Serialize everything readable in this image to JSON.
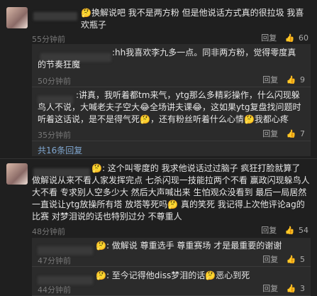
{
  "comments": [
    {
      "text": "🤔换解说吧 我不是两方粉 但是他说话方式真的很拉圾 我喜欢瓶子",
      "time": "55分钟前",
      "reply_label": "回复",
      "likes": "60",
      "replies": [
        {
          "text": ":hh我喜欢李九多一点。同非两方粉，觉得零度真的节奏狂魔",
          "time": "50分钟前",
          "reply_label": "回复",
          "likes": "9"
        },
        {
          "text": ":讲真，我听着都tm来气，ytg那么多精彩操作，什么闪现躲鸟人不说，大喊老夫子空大😂全场讲夫课😂，这如果ytg复盘找问题时听着这话说，是不是得气死🤔，还有粉丝听着什么心情🤔我都心疼",
          "time": "35分钟前",
          "reply_label": "回复",
          "likes": "7"
        }
      ],
      "more_label": "共16条回复"
    },
    {
      "text": "🤔: 这个叫零度的 我求他说话过过脑子 疯狂打脸就算了 做解说从来不看人家发挥完点 七杀闪现一技能拉两个不看 赢政闪现躲鸟人大不看 专求别人空多少大 然后大声喊出来 生怕观众没看到 最后一局居然一直说让ytg放操所有塔 放塔等死吗🤔 真的笑死 我记得上次他评论ag的比赛 对梦泪说的话也特别过分 不尊重人",
      "time": "48分钟前",
      "reply_label": "回复",
      "likes": "54",
      "replies": [
        {
          "text": "🤔: 做解说 尊重选手 尊重赛场 才是最重要的谢谢",
          "time": "47分钟前",
          "reply_label": "回复",
          "likes": "5"
        },
        {
          "text": "🤔: 至今记得他diss梦泪的话🤔恶心到死",
          "time": "44分钟前",
          "reply_label": "回复",
          "likes": "3"
        }
      ]
    }
  ]
}
